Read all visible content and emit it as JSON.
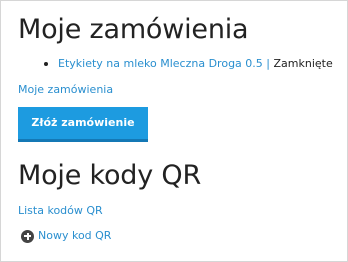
{
  "orders": {
    "heading": "Moje zamówienia",
    "items": [
      {
        "label": "Etykiety na mleko Mleczna Droga 0.5",
        "separator": "|",
        "status": "Zamknięte"
      }
    ],
    "my_orders_link": "Moje zamówienia",
    "place_order_button": "Złóż zamówienie"
  },
  "qr": {
    "heading": "Moje kody QR",
    "list_link": "Lista kodów QR",
    "new_link": "Nowy kod QR",
    "new_icon": "plus-circle-icon"
  },
  "colors": {
    "link": "#2a8fcf",
    "button": "#1d9be0",
    "text": "#222222"
  }
}
